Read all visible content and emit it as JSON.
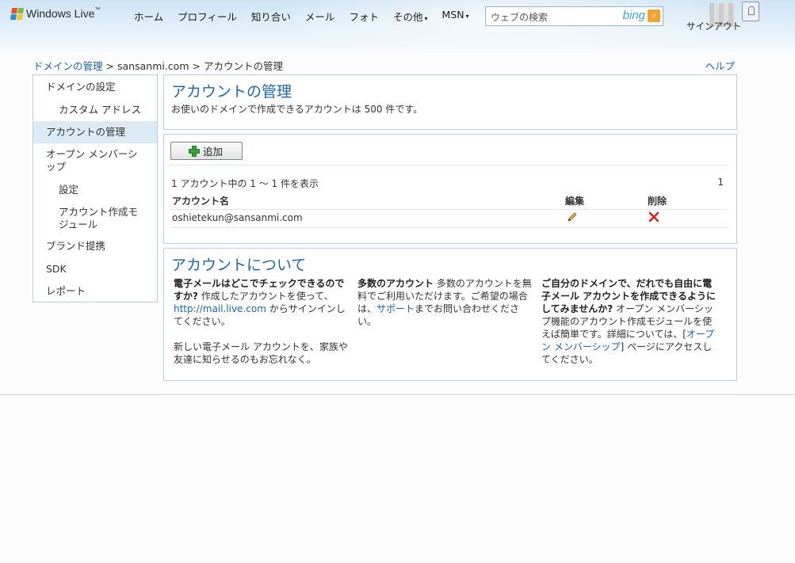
{
  "header": {
    "brand": "Windows Live",
    "trademark": "™",
    "nav": [
      {
        "label": "ホーム",
        "has_caret": false
      },
      {
        "label": "プロフィール",
        "has_caret": false
      },
      {
        "label": "知り合い",
        "has_caret": false
      },
      {
        "label": "メール",
        "has_caret": false
      },
      {
        "label": "フォト",
        "has_caret": false
      },
      {
        "label": "その他",
        "has_caret": true
      },
      {
        "label": "MSN",
        "has_caret": true
      }
    ],
    "caret_glyph": "▾",
    "search_placeholder": "ウェブの検索",
    "search_brand": "bing",
    "sign_in": "サインアウト"
  },
  "breadcrumb": {
    "items": [
      "ドメインの管理",
      "sansanmi.com",
      "アカウントの管理"
    ],
    "separator": ">"
  },
  "help_link": "ヘルプ",
  "sidebar": {
    "items": [
      {
        "label": "ドメインの設定",
        "indent": 0,
        "active": false
      },
      {
        "label": "カスタム アドレス",
        "indent": 1,
        "active": false
      },
      {
        "label": "アカウントの管理",
        "indent": 0,
        "active": true
      },
      {
        "label": "オープン メンバーシップ",
        "indent": 0,
        "active": false
      },
      {
        "label": "設定",
        "indent": 1,
        "active": false
      },
      {
        "label": "アカウント作成モジュール",
        "indent": 1,
        "active": false
      },
      {
        "label": "ブランド提携",
        "indent": 0,
        "active": false
      },
      {
        "label": "SDK",
        "indent": 0,
        "active": false
      },
      {
        "label": "レポート",
        "indent": 0,
        "active": false
      }
    ]
  },
  "main": {
    "title": "アカウントの管理",
    "description": "お使いのドメインで作成できるアカウントは 500 件です。",
    "add_button": "追加",
    "range_text": "1 アカウント中の 1 ～ 1 件を表示",
    "page_number": "1",
    "table": {
      "headers": [
        "アカウント名",
        "編集",
        "削除"
      ],
      "rows": [
        {
          "account": "oshietekun@sansanmi.com"
        }
      ]
    }
  },
  "about": {
    "title": "アカウントについて",
    "col1": {
      "bold": "電子メールはどこでチェックできるのですか?",
      "text1": " 作成したアカウントを使って、",
      "link": "http://mail.live.com",
      "text2": " からサインインしてください。",
      "para2": "新しい電子メール アカウントを、家族や友達に知らせるのもお忘れなく。"
    },
    "col2": {
      "bold": "多数のアカウント",
      "text1": " 多数のアカウントを無料でご利用いただけます。ご希望の場合は、",
      "link": "サポート",
      "text2": "までお問い合わせください。"
    },
    "col3": {
      "bold": "ご自分のドメインで、だれでも自由に電子メール アカウントを作成できるようにしてみませんか?",
      "text1": " オープン メンバーシップ機能のアカウント作成モジュールを使えば簡単です。詳細については、[",
      "link": "オープン メンバーシップ",
      "text2": "] ページにアクセスしてください。"
    }
  },
  "colors": {
    "accent": "#2266a8",
    "link": "#1f63a8",
    "panel_border": "#b7d1e4",
    "active_bg": "#dbeaf5"
  }
}
